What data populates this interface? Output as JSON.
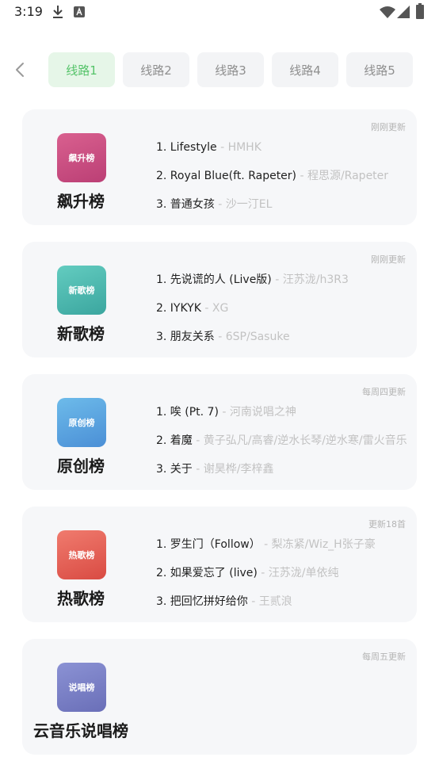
{
  "status": {
    "time": "3:19"
  },
  "tabs": [
    {
      "label": "线路1",
      "active": true
    },
    {
      "label": "线路2",
      "active": false
    },
    {
      "label": "线路3",
      "active": false
    },
    {
      "label": "线路4",
      "active": false
    },
    {
      "label": "线路5",
      "active": false
    }
  ],
  "charts": [
    {
      "title": "飙升榜",
      "cover_text": "飙升榜",
      "badge": "刚刚更新",
      "cover_colors": [
        "#d9608f",
        "#bb3f75"
      ],
      "songs": [
        {
          "label": "1. Lifestyle",
          "artist": " - HMHK"
        },
        {
          "label": "2. Royal Blue(ft. Rapeter)",
          "artist": " - 程思源/Rapeter"
        },
        {
          "label": "3. 普通女孩",
          "artist": " - 沙一汀EL"
        }
      ]
    },
    {
      "title": "新歌榜",
      "cover_text": "新歌榜",
      "badge": "刚刚更新",
      "cover_colors": [
        "#63ccc0",
        "#3ba69f"
      ],
      "songs": [
        {
          "label": "1. 先说谎的人 (Live版)",
          "artist": " - 汪苏泷/h3R3"
        },
        {
          "label": "2. IYKYK",
          "artist": " - XG"
        },
        {
          "label": "3. 朋友关系",
          "artist": " - 6SP/Sasuke"
        }
      ]
    },
    {
      "title": "原创榜",
      "cover_text": "原创榜",
      "badge": "每周四更新",
      "cover_colors": [
        "#6dbbea",
        "#4b8fd6"
      ],
      "songs": [
        {
          "label": "1. 唉 (Pt. 7)",
          "artist": " - 河南说唱之神"
        },
        {
          "label": "2. 着魔",
          "artist": " - 黄子弘凡/高睿/逆水长琴/逆水寒/雷火音乐"
        },
        {
          "label": "3. 关于",
          "artist": " - 谢昊桦/李梓鑫"
        }
      ]
    },
    {
      "title": "热歌榜",
      "cover_text": "热歌榜",
      "badge": "更新18首",
      "cover_colors": [
        "#f07b6e",
        "#d94b43"
      ],
      "songs": [
        {
          "label": "1. 罗生门（Follow）",
          "artist": " - 梨冻紧/Wiz_H张子豪"
        },
        {
          "label": "2. 如果爱忘了 (live)",
          "artist": " - 汪苏泷/单依纯"
        },
        {
          "label": "3. 把回忆拼好给你",
          "artist": " - 王贰浪"
        }
      ]
    },
    {
      "title": "云音乐说唱榜",
      "cover_text": "说唱榜",
      "badge": "每周五更新",
      "cover_colors": [
        "#8b92d4",
        "#6a6fb8"
      ],
      "songs": []
    }
  ]
}
